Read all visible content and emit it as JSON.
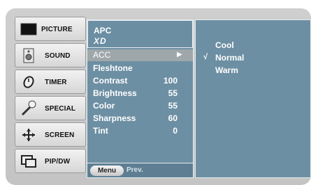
{
  "tabs": [
    {
      "label": "PICTURE",
      "icon": "picture-icon",
      "active": true
    },
    {
      "label": "SOUND",
      "icon": "speaker-icon",
      "active": false
    },
    {
      "label": "TIMER",
      "icon": "clock-icon",
      "active": false
    },
    {
      "label": "SPECIAL",
      "icon": "special-icon",
      "active": false
    },
    {
      "label": "SCREEN",
      "icon": "screen-adjust-icon",
      "active": false
    },
    {
      "label": "PIP/DW",
      "icon": "pip-icon",
      "active": false
    }
  ],
  "picture_menu": {
    "apc_label": "APC",
    "xd_label": "XD",
    "selected_item": {
      "label": "ACC",
      "arrow": "▶"
    },
    "items": [
      {
        "label": "Fleshtone",
        "value": ""
      },
      {
        "label": "Contrast",
        "value": "100"
      },
      {
        "label": "Brightness",
        "value": "55"
      },
      {
        "label": "Color",
        "value": "55"
      },
      {
        "label": "Sharpness",
        "value": "60"
      },
      {
        "label": "Tint",
        "value": "0"
      }
    ],
    "menu_button": "Menu",
    "prev_label": "Prev."
  },
  "acc_submenu": {
    "options": [
      {
        "label": "Cool",
        "checked": false
      },
      {
        "label": "Normal",
        "checked": true
      },
      {
        "label": "Warm",
        "checked": false
      }
    ],
    "check_mark": "√"
  },
  "colors": {
    "panel": "#6d8fa3",
    "highlight": "#9fa7ab",
    "frame": "#c8c8c8"
  }
}
